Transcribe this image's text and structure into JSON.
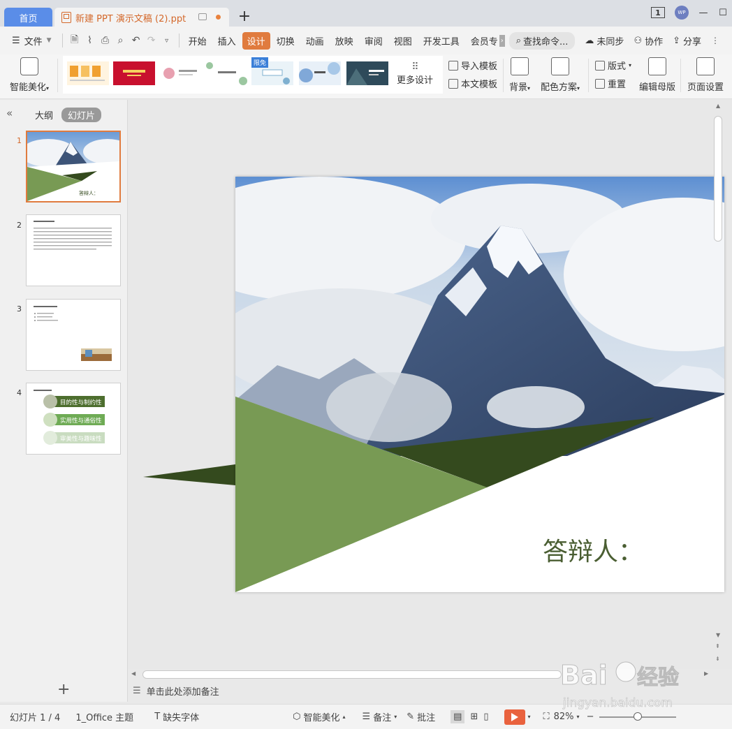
{
  "titlebar": {
    "home_tab": "首页",
    "doc_tab": "新建 PPT 演示文稿 (2).ppt",
    "new_tab_symbol": "+",
    "window_badge": "1",
    "avatar_text": "WP",
    "minimize": "—",
    "maximize": "☐"
  },
  "menu": {
    "file": "文件",
    "items": [
      "开始",
      "插入",
      "设计",
      "切换",
      "动画",
      "放映",
      "审阅",
      "视图",
      "开发工具",
      "会员专"
    ],
    "active_index": 2,
    "search_placeholder": "查找命令...",
    "sync": "未同步",
    "collab": "协作",
    "share": "分享"
  },
  "ribbon": {
    "smart_beautify": "智能美化",
    "more_designs": "更多设计",
    "limited_tag": "限免",
    "import_template": "导入模板",
    "this_template": "本文模板",
    "background": "背景",
    "color_scheme": "配色方案",
    "layout": "版式",
    "reset": "重置",
    "edit_master": "编辑母版",
    "page_setup": "页面设置",
    "template_thumbs": [
      {
        "bg": "#fff4e0",
        "accent": "#f0a030"
      },
      {
        "bg": "#c8102e",
        "accent": "#f5d060"
      },
      {
        "bg": "#fff",
        "accent": "#e8a0b0"
      },
      {
        "bg": "#fff",
        "accent": "#9bc7a0"
      },
      {
        "bg": "#eaf3f8",
        "accent": "#7fb0d0"
      },
      {
        "bg": "#e8f0f8",
        "accent": "#80a8d8"
      },
      {
        "bg": "#2e4a5a",
        "accent": "#ffffff"
      }
    ]
  },
  "left_panel": {
    "outline_tab": "大纲",
    "slides_tab": "幻灯片",
    "slides": [
      {
        "num": "1",
        "caption": "答辩人："
      },
      {
        "num": "2"
      },
      {
        "num": "3"
      },
      {
        "num": "4",
        "items": [
          "目的性与制约性",
          "实用性与通俗性",
          "审美性与趣味性"
        ]
      }
    ],
    "add_symbol": "+"
  },
  "slide": {
    "respondent_label": "答辩人：",
    "colors": {
      "dark_green": "#344a1e",
      "light_green": "#789a54"
    }
  },
  "notes": {
    "placeholder": "单击此处添加备注"
  },
  "status": {
    "slide_counter": "幻灯片 1 / 4",
    "theme": "1_Office 主题",
    "missing_font": "缺失字体",
    "smart_beautify": "智能美化",
    "notes": "备注",
    "comments": "批注",
    "zoom": "82%",
    "zoom_fraction": 0.5
  },
  "watermark": {
    "brand": "Bai经验",
    "url": "jingyan.baidu.com"
  }
}
